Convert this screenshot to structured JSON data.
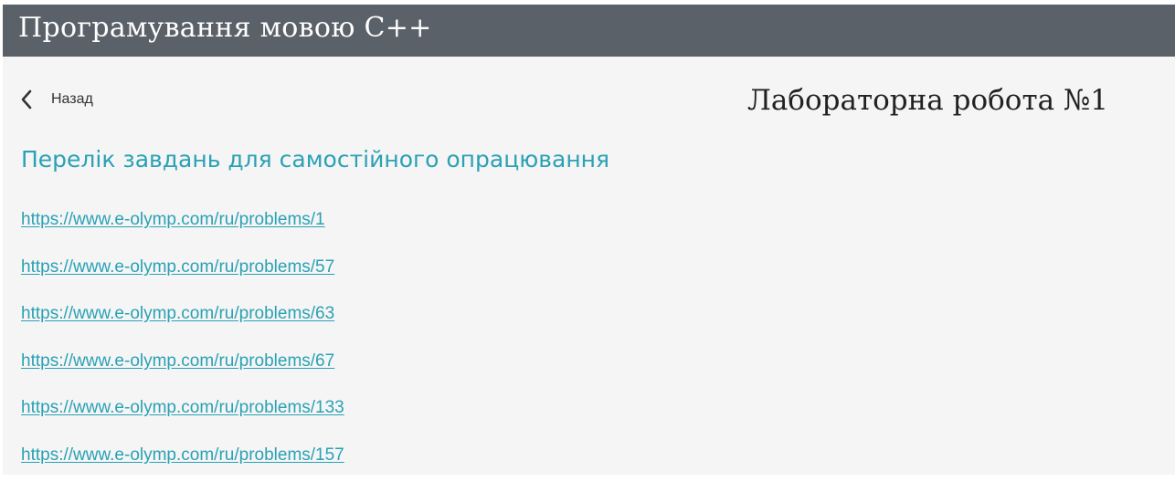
{
  "header": {
    "title": "Програмування мовою C++"
  },
  "nav": {
    "back_label": "Назад",
    "back_icon": "chevron-left-icon"
  },
  "page": {
    "title": "Лабораторна робота №1",
    "section_heading": "Перелік завдань для самостійного опрацювання"
  },
  "links": [
    "https://www.e-olymp.com/ru/problems/1",
    "https://www.e-olymp.com/ru/problems/57",
    "https://www.e-olymp.com/ru/problems/63",
    "https://www.e-olymp.com/ru/problems/67",
    "https://www.e-olymp.com/ru/problems/133",
    "https://www.e-olymp.com/ru/problems/157"
  ],
  "colors": {
    "header_bg": "#5a6169",
    "accent": "#2aa1b5",
    "content_bg": "#f5f5f5"
  }
}
